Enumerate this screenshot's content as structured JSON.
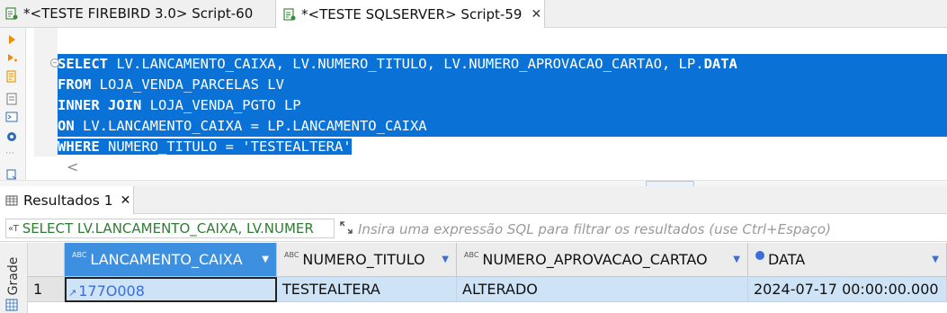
{
  "tabs": [
    {
      "label": "*<TESTE FIREBIRD 3.0> Script-60",
      "active": false
    },
    {
      "label": "*<TESTE SQLSERVER> Script-59",
      "active": true,
      "close": "✕"
    }
  ],
  "gutter_icons": [
    "execute-icon",
    "execute-script-icon",
    "explain-icon",
    "console-icon",
    "settings-icon",
    "more-icon",
    "export-icon"
  ],
  "sql_lines": [
    {
      "kw": "SELECT",
      "rest": " LV.LANCAMENTO_CAIXA, LV.NUMERO_TITULO, LV.NUMERO_APROVACAO_CARTAO, LP.",
      "kw2": "DATA"
    },
    {
      "kw": "FROM",
      "rest": " LOJA_VENDA_PARCELAS LV",
      "kw2": ""
    },
    {
      "kw": "INNER JOIN",
      "rest": " LOJA_VENDA_PGTO LP",
      "kw2": ""
    },
    {
      "kw": "ON",
      "rest": " LV.LANCAMENTO_CAIXA = LP.LANCAMENTO_CAIXA",
      "kw2": ""
    },
    {
      "kw": "WHERE",
      "rest": " NUMERO_TITULO = 'TESTEALTERA'",
      "kw2": ""
    }
  ],
  "scroll_arrow": "<",
  "results_tab": {
    "label": "Resultados 1",
    "close": "✕"
  },
  "filter": {
    "query_text": "SELECT LV.LANCAMENTO_CAIXA, LV.NUMER",
    "placeholder": "Insira uma expressão SQL para filtrar os resultados (use Ctrl+Espaço)"
  },
  "side_label": "Grade",
  "columns": [
    {
      "name": "LANCAMENTO_CAIXA",
      "type_badge": "ABC"
    },
    {
      "name": "NUMERO_TITULO",
      "type_badge": "ABC"
    },
    {
      "name": "NUMERO_APROVACAO_CARTAO",
      "type_badge": "ABC"
    },
    {
      "name": "DATA",
      "type_badge": "clock"
    }
  ],
  "rows": [
    {
      "num": "1",
      "cells": [
        "177O008",
        "TESTEALTERA",
        "ALTERADO",
        "2024-07-17 00:00:00.000"
      ]
    }
  ],
  "colors": {
    "selection": "#0a72d6",
    "header_active": "#3d8fe0",
    "row_selected": "#cfe3f7",
    "filter_query": "#2e7d32"
  }
}
